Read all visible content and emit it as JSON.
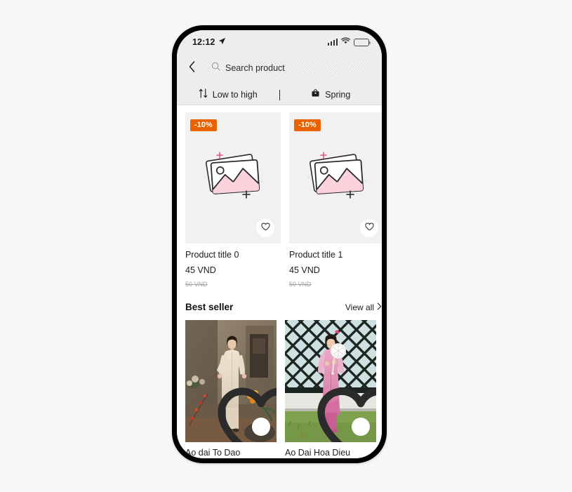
{
  "statusbar": {
    "time": "12:12",
    "location_icon": "location-arrow-icon",
    "signal_icon": "cellular-signal-icon",
    "wifi_icon": "wifi-icon",
    "battery_icon": "battery-full-icon"
  },
  "header": {
    "back_icon": "chevron-left-icon",
    "search": {
      "icon": "search-icon",
      "placeholder": "Search product",
      "value": ""
    }
  },
  "filters": [
    {
      "icon": "sort-arrows-icon",
      "label": "Low to high",
      "name": "filter-sort"
    },
    {
      "icon": "bag-icon",
      "label": "Spring",
      "name": "filter-season"
    }
  ],
  "products": [
    {
      "badge": "-10%",
      "title": "Product title 0",
      "price": "45 VND",
      "old_price": "50 VND",
      "fav_icon": "heart-outline-icon",
      "image": "image-placeholder"
    },
    {
      "badge": "-10%",
      "title": "Product title 1",
      "price": "45 VND",
      "old_price": "50 VND",
      "fav_icon": "heart-outline-icon",
      "image": "image-placeholder"
    }
  ],
  "best_seller": {
    "title": "Best seller",
    "view_all": "View all",
    "view_all_icon": "chevron-right-icon",
    "items": [
      {
        "title": "Ao dai To Dao",
        "fav_icon": "heart-outline-icon"
      },
      {
        "title": "Ao Dai Hoa Dieu",
        "fav_icon": "heart-outline-icon"
      }
    ]
  },
  "colors": {
    "badge_orange": "#ea6100",
    "header_gray": "#efedeb",
    "card_gray": "#f1f1f1",
    "placeholder_pink": "#fad2dc",
    "text_dark": "#1c1c1c",
    "page_bg": "#f7f7f7"
  }
}
